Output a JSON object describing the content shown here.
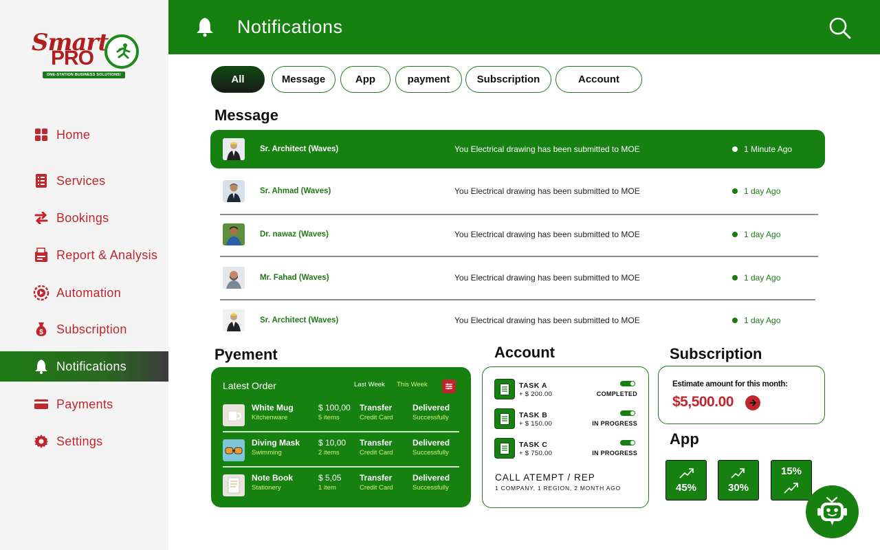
{
  "brand": {
    "logo_script": "Smart",
    "logo_pro": "PRO",
    "tagline": "ONE-STATION BUSINESS SOLUTIONS!"
  },
  "sidebar": {
    "items": [
      {
        "label": "Home",
        "icon": "home-grid-icon"
      },
      {
        "label": "Services",
        "icon": "services-list-icon"
      },
      {
        "label": "Bookings",
        "icon": "bookings-arrows-icon"
      },
      {
        "label": "Report & Analysis",
        "icon": "report-icon"
      },
      {
        "label": "Automation",
        "icon": "automation-icon"
      },
      {
        "label": "Subscription",
        "icon": "money-bag-icon"
      },
      {
        "label": "Notifications",
        "icon": "bell-icon"
      },
      {
        "label": "Payments",
        "icon": "card-icon"
      },
      {
        "label": "Settings",
        "icon": "gear-icon"
      }
    ],
    "active": "Notifications"
  },
  "header": {
    "title": "Notifications"
  },
  "tabs": [
    "All",
    "Message",
    "App",
    "payment",
    "Subscription",
    "Account"
  ],
  "active_tab": "All",
  "messages": {
    "title": "Message",
    "rows": [
      {
        "name": "Sr. Architect (Waves)",
        "text": "You Electrical drawing has been submitted to MOE",
        "time": "1 Minute Ago"
      },
      {
        "name": "Sr. Ahmad  (Waves)",
        "text": "You Electrical drawing has been submitted to MOE",
        "time": "1 day Ago"
      },
      {
        "name": "Dr. nawaz  (Waves)",
        "text": "You Electrical drawing has been submitted to MOE",
        "time": "1 day Ago"
      },
      {
        "name": "Mr. Fahad (Waves)",
        "text": "You Electrical drawing has been submitted to MOE",
        "time": "1 day Ago"
      },
      {
        "name": "Sr. Architect (Waves)",
        "text": "You Electrical drawing has been submitted to MOE",
        "time": "1 day Ago"
      }
    ]
  },
  "payment": {
    "title": "Pyement",
    "card_title": "Latest Order",
    "filter_last": "Last Week",
    "filter_this": "This Week",
    "orders": [
      {
        "item": "White Mug",
        "category": "Kitchenware",
        "amount": "$ 100,00",
        "qty": "5 items",
        "method": "Transfer",
        "method_sub": "Credit Card",
        "status": "Delivered",
        "status_sub": "Successfully"
      },
      {
        "item": "Diving Mask",
        "category": "Swimming",
        "amount": "$ 10,00",
        "qty": "2 items",
        "method": "Transfer",
        "method_sub": "Credit Card",
        "status": "Delivered",
        "status_sub": "Successfully"
      },
      {
        "item": "Note Book",
        "category": "Stationery",
        "amount": "$ 5,05",
        "qty": "1 item",
        "method": "Transfer",
        "method_sub": "Credit Card",
        "status": "Delivered",
        "status_sub": "Successfully"
      }
    ]
  },
  "account": {
    "title": "Account",
    "tasks": [
      {
        "name": "TASK A",
        "amount": "+ $ 200.00",
        "status": "COMPLETED"
      },
      {
        "name": "TASK B",
        "amount": "+ $ 150.00",
        "status": "IN PROGRESS"
      },
      {
        "name": "TASK C",
        "amount": "+ $ 750.00",
        "status": "IN PROGRESS"
      }
    ],
    "call_title": "CALL ATEMPT / REP",
    "call_sub": "1 COMPANY, 1 REGION, 2 MONTH AGO"
  },
  "subscription": {
    "title": "Subscription",
    "label": "Estimate amount for this month:",
    "amount": "$5,500.00"
  },
  "app": {
    "title": "App",
    "stats": [
      {
        "value": "45%",
        "trend": "up"
      },
      {
        "value": "30%",
        "trend": "up"
      },
      {
        "value": "15%",
        "trend": "up"
      }
    ]
  },
  "colors": {
    "brand_green": "#168010",
    "accent_red": "#c0272d",
    "highlight_yellow": "#d6f27a"
  }
}
